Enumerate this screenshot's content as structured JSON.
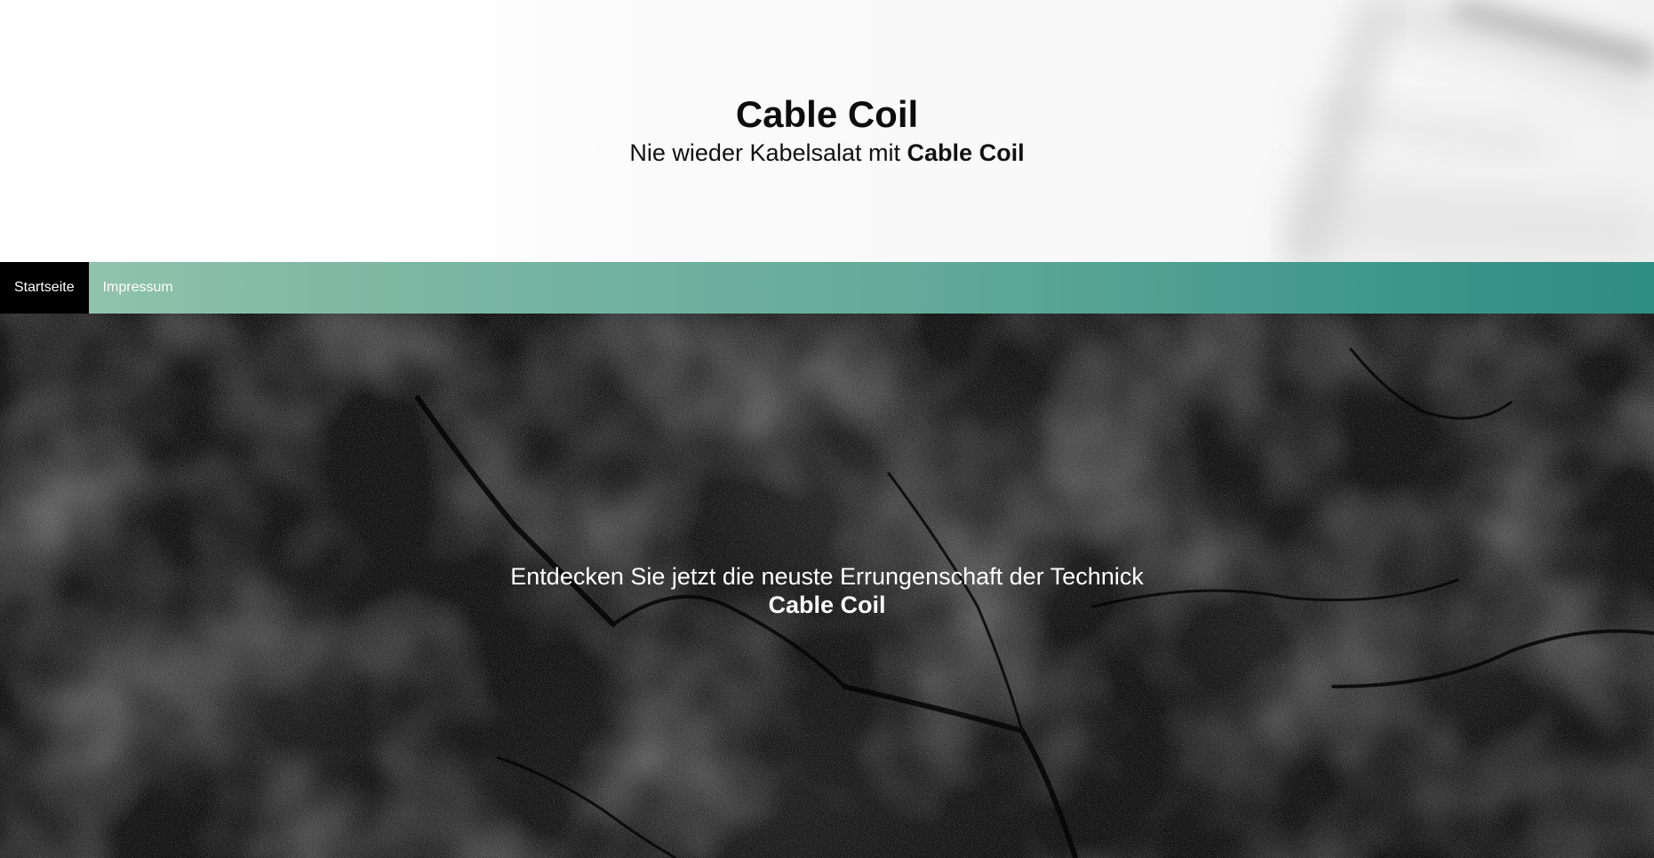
{
  "header": {
    "title": "Cable Coil",
    "tagline_prefix": "Nie wieder Kabelsalat mit ",
    "tagline_emphasis": "Cable Coil"
  },
  "nav": {
    "items": [
      {
        "label": "Startseite",
        "active": true
      },
      {
        "label": "Impressum",
        "active": false
      }
    ],
    "gradient_start": "#95c7ad",
    "gradient_end": "#2e8d82"
  },
  "hero": {
    "line1": "Entdecken Sie jetzt die neuste Errungenschaft der Technick",
    "line2": "Cable Coil"
  }
}
